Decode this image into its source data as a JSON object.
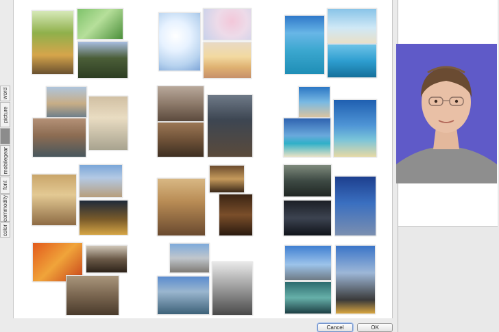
{
  "side_tabs": {
    "color": "color",
    "commodity": "commodity",
    "font": "font",
    "mobilegear": "mobilegear",
    "selected_blank": "",
    "picture": "picture",
    "word": "word"
  },
  "buttons": {
    "cancel": "Cancel",
    "ok": "OK"
  },
  "icons": {
    "portrait": "portrait-photo-icon"
  }
}
